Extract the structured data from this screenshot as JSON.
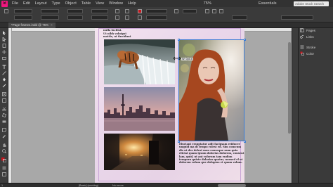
{
  "app": {
    "logo": "Id"
  },
  "menu": {
    "items": [
      "File",
      "Edit",
      "Layout",
      "Type",
      "Object",
      "Table",
      "View",
      "Window",
      "Help"
    ],
    "zoom": "75%",
    "workspace": "Essentials",
    "search_placeholder": "Adobe Stock Search"
  },
  "document": {
    "tab_title": "*Page frames.indd @ 75%",
    "tab_close": "×"
  },
  "page_text": {
    "top": [
      "nulla facilisi.",
      "Ut nibh volutpat",
      "mattis, ut tincidunt"
    ],
    "bottom": "Eluctant ersuptatur adit facipsam eriducer unquid ma di tempo rolest ed. Sim comcum dis ut des delest mon conseque num quia eliciat quam ipsum dolorias dolorem, consent lam, quid, ut ant volorum tam endion temporu quiste dolorias quatur, nonsed el ut dolorem volum que doluptas et quam volum."
  },
  "tooltip": "W: 0p0.6",
  "panels": {
    "items": [
      {
        "label": "Pages",
        "icon": "pages-icon"
      },
      {
        "label": "Links",
        "icon": "links-icon"
      },
      {
        "label": "Stroke",
        "icon": "stroke-icon"
      },
      {
        "label": "Color",
        "icon": "color-icon"
      }
    ]
  },
  "status": {
    "page": "1",
    "style": "[Basic] (working)",
    "preflight": "No errors"
  },
  "colors": {
    "accent": "#f0177f",
    "selection": "#3a7bd5",
    "page_bg": "#efdfec"
  }
}
